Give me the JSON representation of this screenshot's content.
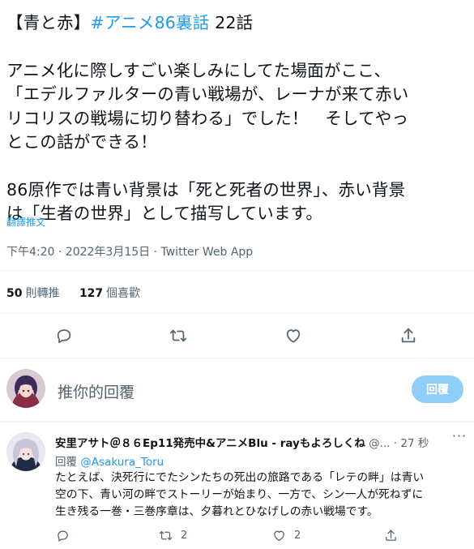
{
  "tweet": {
    "lines": [
      {
        "pre": "【青と赤】",
        "hashtag": "#アニメ86裏話",
        "post": " 22話"
      },
      {
        "text": ""
      },
      {
        "text": "アニメ化に際しすごい楽しみにしてた場面がここ、"
      },
      {
        "text": "「エデルファルターの青い戦場が、レーナが来て赤い"
      },
      {
        "text": "リコリスの戦場に切り替わる」でした！　そしてやっ"
      },
      {
        "text": "とこの話ができる！"
      },
      {
        "text": ""
      },
      {
        "text": "86原作では青い背景は「死と死者の世界」、赤い背景"
      },
      {
        "text": "は「生者の世界」として描写しています。"
      }
    ],
    "translate": "翻譯推文",
    "timestamp": "下午4:20 · 2022年3月15日 · ",
    "app": "Twitter Web App",
    "stats": {
      "retweets_count": "50",
      "retweets_label": "則轉推",
      "likes_count": "127",
      "likes_label": "個喜歡"
    }
  },
  "compose": {
    "placeholder": "推你的回覆",
    "button": "回覆"
  },
  "reply": {
    "name": "安里アサト＠８６Ep11発売中&アニメBlu - rayもよろしくね",
    "handle": " @...",
    "time": " · 27 秒",
    "more": "···",
    "replying_prefix": "回覆 ",
    "replying_to": "@Asakura_Toru",
    "lines": [
      "たとえば、決死行にでたシンたちの死出の旅路である「レテの畔」は青い",
      "空の下、青い河の畔でストーリーが始まり、一方で、シン一人が死ねずに",
      "生き残る一巻・三巻序章は、夕暮れとひなげしの赤い戦場です。"
    ],
    "retweet_count": "2",
    "like_count": "2"
  },
  "colors": {
    "accent": "#1d9bf0",
    "muted": "#536471",
    "reply_button": "#8ecdf8"
  },
  "icons": [
    "reply-icon",
    "retweet-icon",
    "like-icon",
    "share-icon"
  ]
}
